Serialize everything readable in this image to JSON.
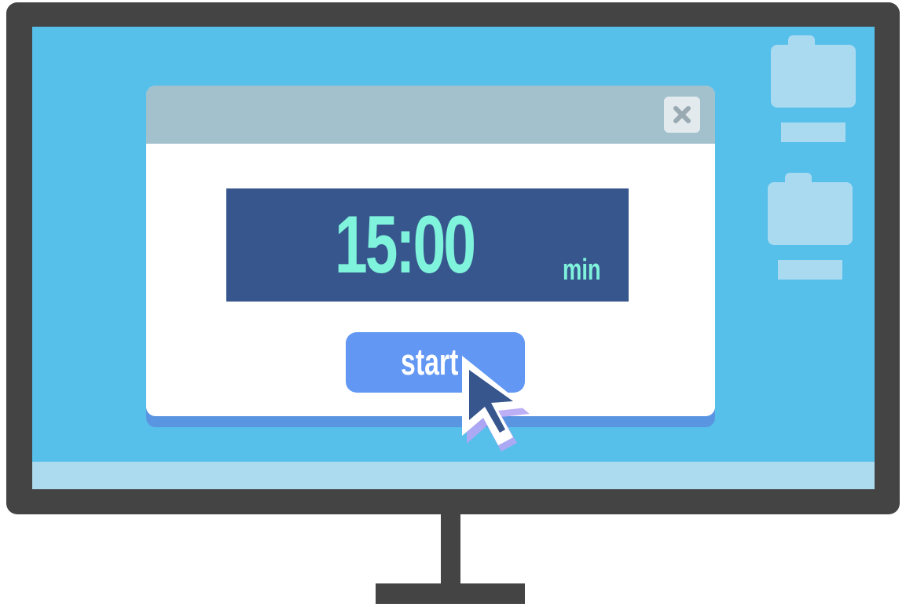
{
  "timer": {
    "value": "15:00",
    "unit": "min"
  },
  "controls": {
    "start_label": "start"
  },
  "desktop": {
    "icons": [
      {
        "icon": "folder-icon"
      },
      {
        "icon": "folder-icon"
      }
    ]
  },
  "colors": {
    "screen": "#56bfea",
    "bezel": "#444444",
    "titlebar": "#a2c1cd",
    "timer_background": "#36568d",
    "timer_text": "#7ff3db",
    "start_button": "#6298f3",
    "taskbar": "#acdaee"
  }
}
